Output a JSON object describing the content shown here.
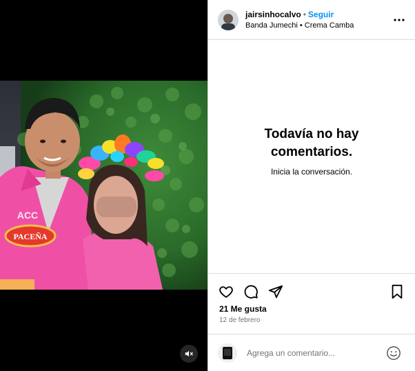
{
  "post": {
    "username": "jairsinhocalvo",
    "separator": "•",
    "follow_label": "Seguir",
    "subtitle": "Banda Jumechi • Crema Camba",
    "likes": "21 Me gusta",
    "date": "12 de febrero"
  },
  "comments": {
    "empty_title": "Todavía no hay comentarios.",
    "empty_subtitle": "Inicia la conversación."
  },
  "composer": {
    "placeholder": "Agrega un comentario..."
  },
  "media": {
    "jersey_text_1": "ACC",
    "jersey_text_2": "PACEÑA"
  },
  "icons": {
    "more": "more-options-icon",
    "like": "heart-icon",
    "comment": "comment-icon",
    "share": "paper-plane-icon",
    "save": "bookmark-icon",
    "emoji": "emoji-icon",
    "mute": "speaker-muted-icon"
  },
  "colors": {
    "follow": "#0095f6",
    "secondary_text": "#737373",
    "border": "#dbdbdb",
    "jersey_pink": "#f04fa6"
  }
}
